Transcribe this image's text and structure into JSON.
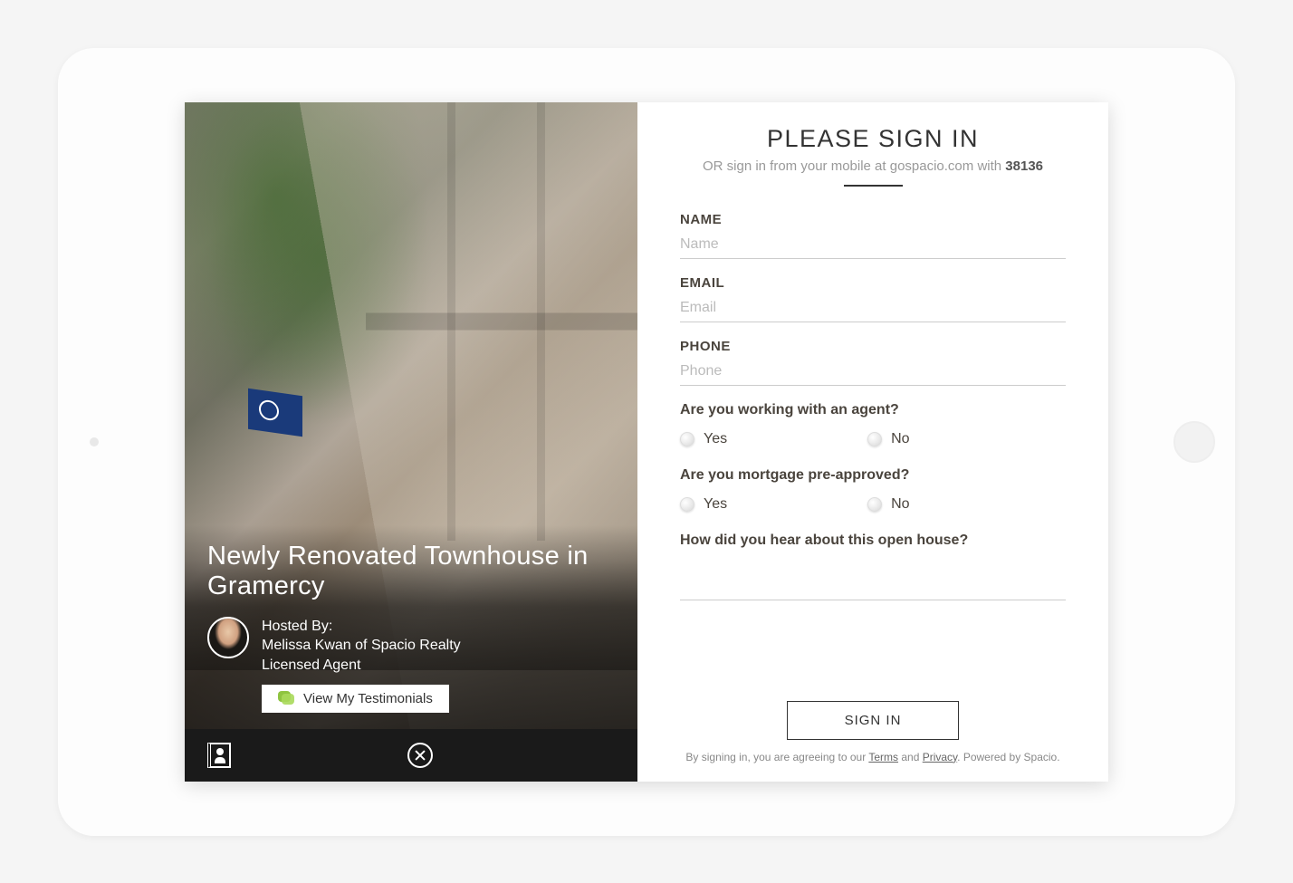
{
  "colors": {
    "accent_green": "#8fc440",
    "text_dark": "#4a443d"
  },
  "left": {
    "property_title": "Newly Renovated Townhouse in Gramercy",
    "hosted_by_label": "Hosted By:",
    "host_name": "Melissa Kwan of Spacio Realty",
    "host_role": "Licensed Agent",
    "testimonials_btn": "View My Testimonials"
  },
  "form": {
    "title": "PLEASE SIGN IN",
    "subtitle_prefix": "OR sign in from your mobile at gospacio.com with ",
    "code": "38136",
    "fields": {
      "name": {
        "label": "NAME",
        "placeholder": "Name"
      },
      "email": {
        "label": "EMAIL",
        "placeholder": "Email"
      },
      "phone": {
        "label": "PHONE",
        "placeholder": "Phone"
      }
    },
    "q_agent": "Are you working with an agent?",
    "q_mortgage": "Are you mortgage pre-approved?",
    "q_hear": "How did you hear about this open house?",
    "yes": "Yes",
    "no": "No",
    "signin_btn": "SIGN IN",
    "terms_prefix": "By signing in, you are agreeing to our ",
    "terms_link": "Terms",
    "terms_and": " and ",
    "privacy_link": "Privacy",
    "terms_suffix": ". Powered by Spacio."
  }
}
